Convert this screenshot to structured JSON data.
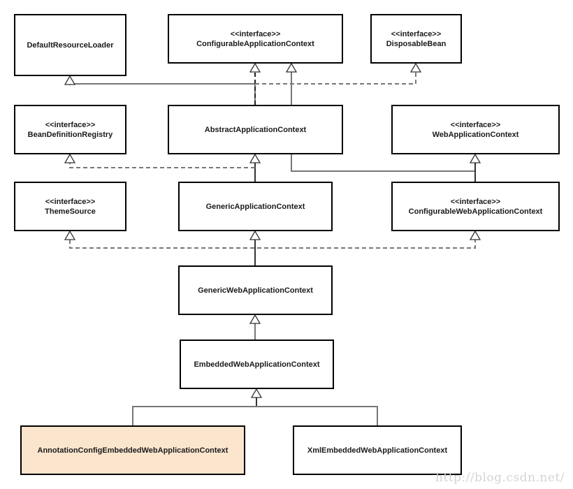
{
  "diagram": {
    "title": "",
    "stereotype": "<<interface>>",
    "classes": [
      {
        "id": "DefaultResourceLoader",
        "name": "DefaultResourceLoader",
        "interface": false,
        "highlight": false
      },
      {
        "id": "ConfigurableApplicationContext",
        "name": "ConfigurableApplicationContext",
        "interface": true,
        "highlight": false
      },
      {
        "id": "DisposableBean",
        "name": "DisposableBean",
        "interface": true,
        "highlight": false
      },
      {
        "id": "BeanDefinitionRegistry",
        "name": "BeanDefinitionRegistry",
        "interface": true,
        "highlight": false
      },
      {
        "id": "AbstractApplicationContext",
        "name": "AbstractApplicationContext",
        "interface": false,
        "highlight": false
      },
      {
        "id": "WebApplicationContext",
        "name": "WebApplicationContext",
        "interface": true,
        "highlight": false
      },
      {
        "id": "ThemeSource",
        "name": "ThemeSource",
        "interface": true,
        "highlight": false
      },
      {
        "id": "GenericApplicationContext",
        "name": "GenericApplicationContext",
        "interface": false,
        "highlight": false
      },
      {
        "id": "ConfigurableWebApplicationContext",
        "name": "ConfigurableWebApplicationContext",
        "interface": true,
        "highlight": false
      },
      {
        "id": "GenericWebApplicationContext",
        "name": "GenericWebApplicationContext",
        "interface": false,
        "highlight": false
      },
      {
        "id": "EmbeddedWebApplicationContext",
        "name": "EmbeddedWebApplicationContext",
        "interface": false,
        "highlight": false
      },
      {
        "id": "AnnotationConfigEmbeddedWebApplicationContext",
        "name": "AnnotationConfigEmbeddedWebApplicationContext",
        "interface": false,
        "highlight": true
      },
      {
        "id": "XmlEmbeddedWebApplicationContext",
        "name": "XmlEmbeddedWebApplicationContext",
        "interface": false,
        "highlight": false
      }
    ],
    "relations": [
      {
        "from": "AbstractApplicationContext",
        "to": "DefaultResourceLoader",
        "type": "extends"
      },
      {
        "from": "AbstractApplicationContext",
        "to": "ConfigurableApplicationContext",
        "type": "implements"
      },
      {
        "from": "AbstractApplicationContext",
        "to": "DisposableBean",
        "type": "implements"
      },
      {
        "from": "WebApplicationContext",
        "to": "ConfigurableApplicationContext",
        "type": "extends"
      },
      {
        "from": "GenericApplicationContext",
        "to": "AbstractApplicationContext",
        "type": "extends"
      },
      {
        "from": "GenericApplicationContext",
        "to": "BeanDefinitionRegistry",
        "type": "implements"
      },
      {
        "from": "ConfigurableWebApplicationContext",
        "to": "WebApplicationContext",
        "type": "extends"
      },
      {
        "from": "GenericWebApplicationContext",
        "to": "GenericApplicationContext",
        "type": "extends"
      },
      {
        "from": "GenericWebApplicationContext",
        "to": "ThemeSource",
        "type": "implements"
      },
      {
        "from": "GenericWebApplicationContext",
        "to": "ConfigurableWebApplicationContext",
        "type": "implements"
      },
      {
        "from": "EmbeddedWebApplicationContext",
        "to": "GenericWebApplicationContext",
        "type": "extends"
      },
      {
        "from": "AnnotationConfigEmbeddedWebApplicationContext",
        "to": "EmbeddedWebApplicationContext",
        "type": "extends"
      },
      {
        "from": "XmlEmbeddedWebApplicationContext",
        "to": "EmbeddedWebApplicationContext",
        "type": "extends"
      }
    ],
    "colors": {
      "highlight_fill": "#fce5cd",
      "border": "#000000",
      "connector": "#777777"
    }
  },
  "watermark": "http://blog.csdn.net/"
}
